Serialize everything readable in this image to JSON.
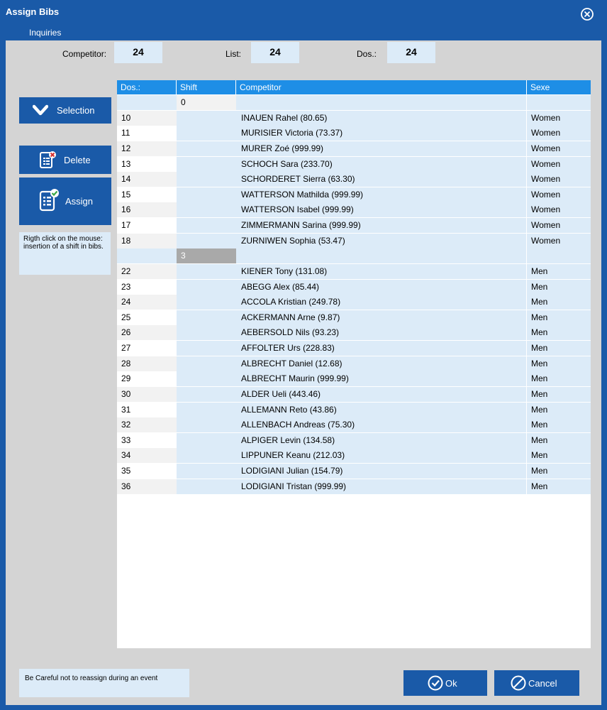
{
  "window": {
    "title": "Assign Bibs"
  },
  "menu": {
    "items": [
      "Inquiries"
    ]
  },
  "fields": {
    "competitor": {
      "label": "Competitor:",
      "value": "24"
    },
    "list": {
      "label": "List:",
      "value": "24"
    },
    "dos": {
      "label": "Dos.:",
      "value": "24"
    }
  },
  "sidebar": {
    "selection_label": "Selection",
    "delete_label": "Delete",
    "assign_label": "Assign",
    "hint": "Rigth click on the mouse: insertion of a shift in bibs."
  },
  "table": {
    "columns": [
      "Dos.:",
      "Shift",
      "Competitor",
      "Sexe"
    ],
    "rows": [
      {
        "dos": "",
        "shift": "0",
        "competitor": "",
        "sex": "",
        "type": "shift"
      },
      {
        "dos": "10",
        "shift": "",
        "competitor": "INAUEN Rahel (80.65)",
        "sex": "Women"
      },
      {
        "dos": "11",
        "shift": "",
        "competitor": "MURISIER Victoria (73.37)",
        "sex": "Women"
      },
      {
        "dos": "12",
        "shift": "",
        "competitor": "MURER Zoé (999.99)",
        "sex": "Women"
      },
      {
        "dos": "13",
        "shift": "",
        "competitor": "SCHOCH Sara (233.70)",
        "sex": "Women"
      },
      {
        "dos": "14",
        "shift": "",
        "competitor": "SCHORDERET Sierra (63.30)",
        "sex": "Women"
      },
      {
        "dos": "15",
        "shift": "",
        "competitor": "WATTERSON Mathilda (999.99)",
        "sex": "Women"
      },
      {
        "dos": "16",
        "shift": "",
        "competitor": "WATTERSON Isabel (999.99)",
        "sex": "Women"
      },
      {
        "dos": "17",
        "shift": "",
        "competitor": "ZIMMERMANN Sarina (999.99)",
        "sex": "Women"
      },
      {
        "dos": "18",
        "shift": "",
        "competitor": "ZURNIWEN Sophia (53.47)",
        "sex": "Women"
      },
      {
        "dos": "",
        "shift": "3",
        "competitor": "",
        "sex": "",
        "type": "shift-selected"
      },
      {
        "dos": "22",
        "shift": "",
        "competitor": "KIENER Tony (131.08)",
        "sex": "Men"
      },
      {
        "dos": "23",
        "shift": "",
        "competitor": "ABEGG Alex (85.44)",
        "sex": "Men"
      },
      {
        "dos": "24",
        "shift": "",
        "competitor": "ACCOLA Kristian (249.78)",
        "sex": "Men"
      },
      {
        "dos": "25",
        "shift": "",
        "competitor": "ACKERMANN Arne (9.87)",
        "sex": "Men"
      },
      {
        "dos": "26",
        "shift": "",
        "competitor": "AEBERSOLD Nils (93.23)",
        "sex": "Men"
      },
      {
        "dos": "27",
        "shift": "",
        "competitor": "AFFOLTER Urs (228.83)",
        "sex": "Men"
      },
      {
        "dos": "28",
        "shift": "",
        "competitor": "ALBRECHT Daniel (12.68)",
        "sex": "Men"
      },
      {
        "dos": "29",
        "shift": "",
        "competitor": "ALBRECHT Maurin (999.99)",
        "sex": "Men"
      },
      {
        "dos": "30",
        "shift": "",
        "competitor": "ALDER Ueli (443.46)",
        "sex": "Men"
      },
      {
        "dos": "31",
        "shift": "",
        "competitor": "ALLEMANN Reto (43.86)",
        "sex": "Men"
      },
      {
        "dos": "32",
        "shift": "",
        "competitor": "ALLENBACH Andreas (75.30)",
        "sex": "Men"
      },
      {
        "dos": "33",
        "shift": "",
        "competitor": "ALPIGER Levin (134.58)",
        "sex": "Men"
      },
      {
        "dos": "34",
        "shift": "",
        "competitor": "LIPPUNER Keanu (212.03)",
        "sex": "Men"
      },
      {
        "dos": "35",
        "shift": "",
        "competitor": "LODIGIANI Julian (154.79)",
        "sex": "Men"
      },
      {
        "dos": "36",
        "shift": "",
        "competitor": "LODIGIANI Tristan (999.99)",
        "sex": "Men"
      }
    ]
  },
  "footer": {
    "note": "Be Careful not to reassign during an event",
    "ok_label": "Ok",
    "cancel_label": "Cancel"
  },
  "colors": {
    "titlebar": "#1a5aa8",
    "header": "#1e8ee6",
    "row_light": "#dcebf8",
    "selected_shift": "#a9a9a9"
  },
  "icons": [
    "close-icon",
    "chevron-down-icon",
    "delete-document-icon",
    "assign-document-icon",
    "check-circle-icon",
    "cancel-circle-icon"
  ]
}
